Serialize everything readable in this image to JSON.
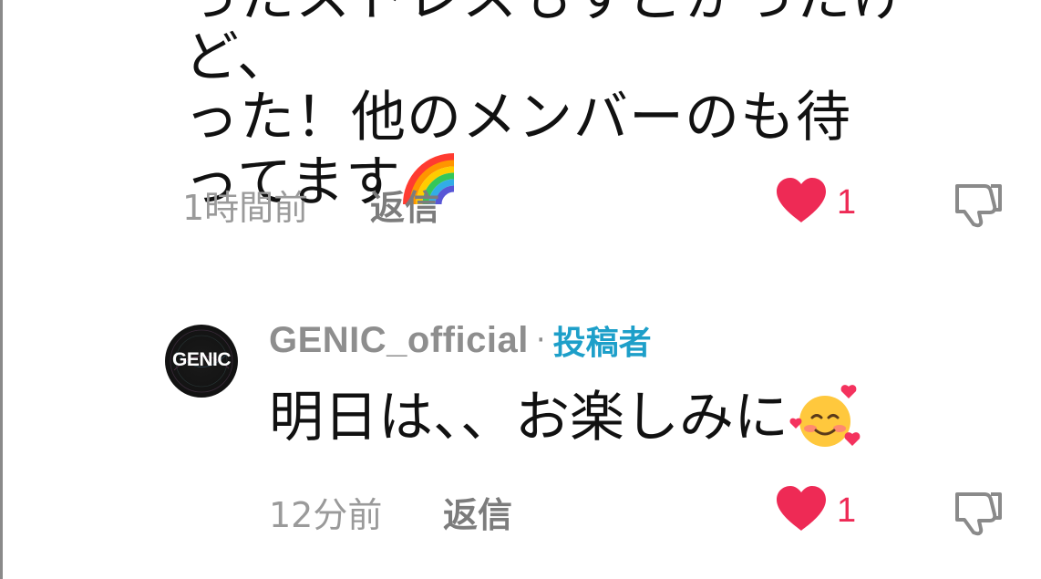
{
  "comments": [
    {
      "text_lines": [
        "ったストレスもすごかったけど、",
        "った！他のメンバーのも待",
        "ってます"
      ],
      "emoji": "rainbow",
      "time": "1時間前",
      "reply_label": "返信",
      "likes": "1",
      "liked": true
    },
    {
      "author": "GENIC_official",
      "separator": "·",
      "badge": "投稿者",
      "avatar_text": "GENIC",
      "text": "明日は、、お楽しみに",
      "emoji": "smiling-face-with-hearts",
      "time": "12分前",
      "reply_label": "返信",
      "likes": "1",
      "liked": true
    }
  ],
  "icons": {
    "like": "heart-icon",
    "dislike": "thumbs-down-icon"
  },
  "colors": {
    "heart": "#ee2a55",
    "badge": "#1d9fc9",
    "muted": "#9a9a9a"
  }
}
